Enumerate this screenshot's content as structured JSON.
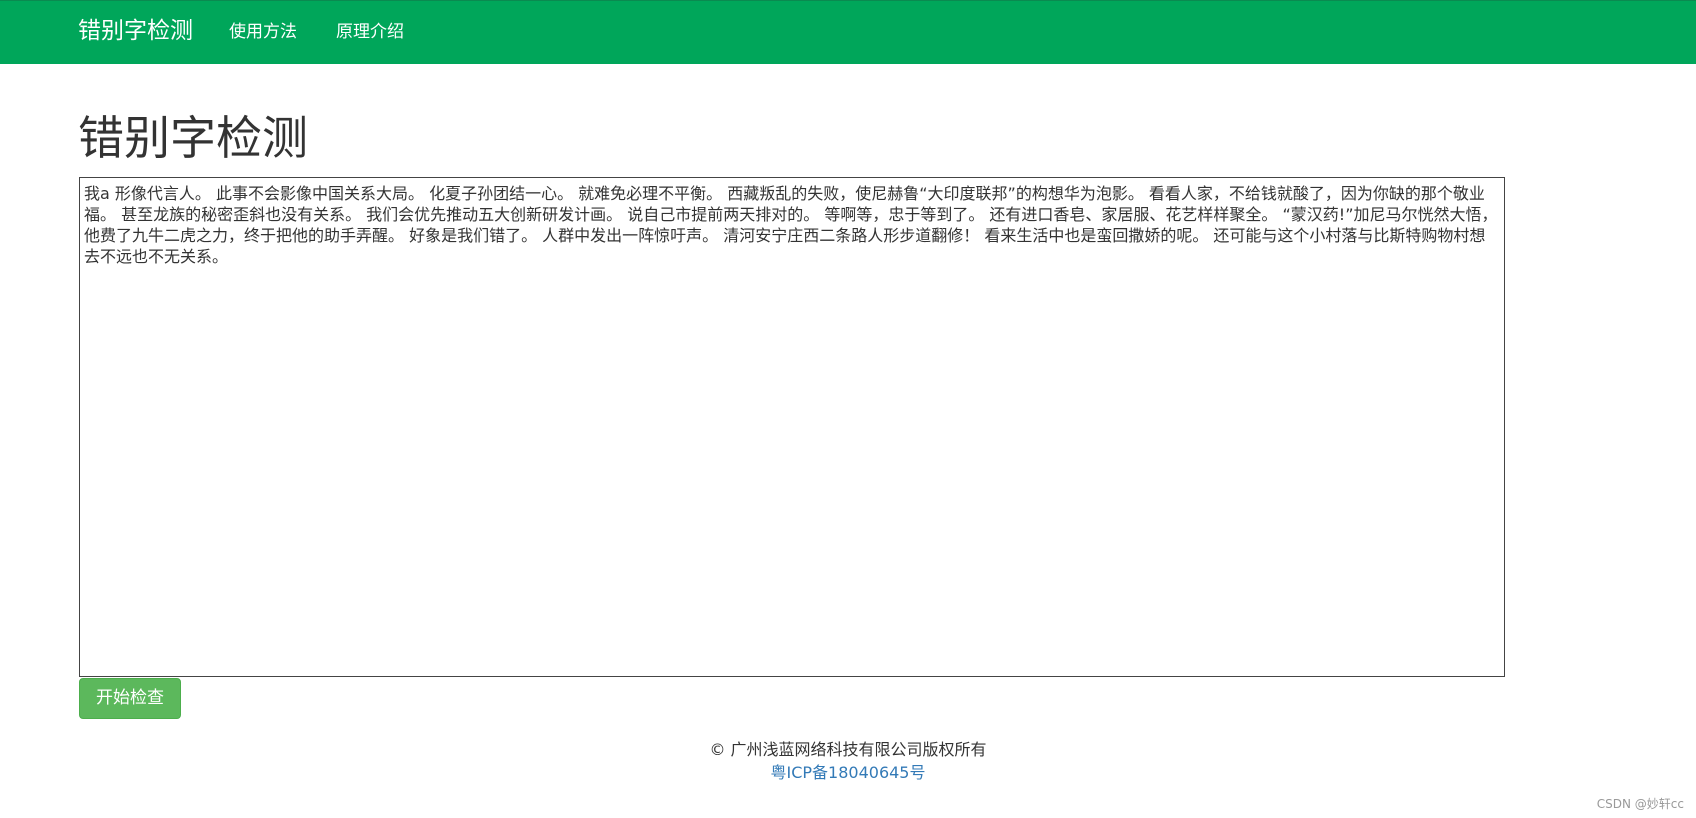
{
  "navbar": {
    "brand": "错别字检测",
    "links": [
      "使用方法",
      "原理介绍"
    ],
    "background_color": "#00a65a"
  },
  "main": {
    "title": "错别字检测",
    "input_text": "我a 形像代言人。 此事不会影像中国关系大局。 化夏子孙团结一心。 就难免必理不平衡。 西藏叛乱的失败，使尼赫鲁“大印度联邦”的构想华为泡影。 看看人家，不给钱就酸了，因为你缺的那个敬业福。 甚至龙族的秘密歪斜也没有关系。 我们会优先推动五大创新研发计画。 说自己市提前两天排对的。 等啊等，忠于等到了。 还有进口香皂、家居服、花艺样样聚全。 “蒙汉药!”加尼马尔恍然大悟，他费了九牛二虎之力，终于把他的助手弄醒。 好象是我们错了。 人群中发出一阵惊吁声。 清河安宁庄西二条路人形步道翻修！ 看来生活中也是蛮回撒娇的呢。 还可能与这个小村落与比斯特购物村想去不远也不无关系。",
    "check_button": "开始检查",
    "button_color": "#5cb85c"
  },
  "footer": {
    "copyright": "© 广州浅蓝网络科技有限公司版权所有",
    "icp": "粤ICP备18040645号",
    "link_color": "#337ab7"
  },
  "watermark": "CSDN @妙轩cc"
}
